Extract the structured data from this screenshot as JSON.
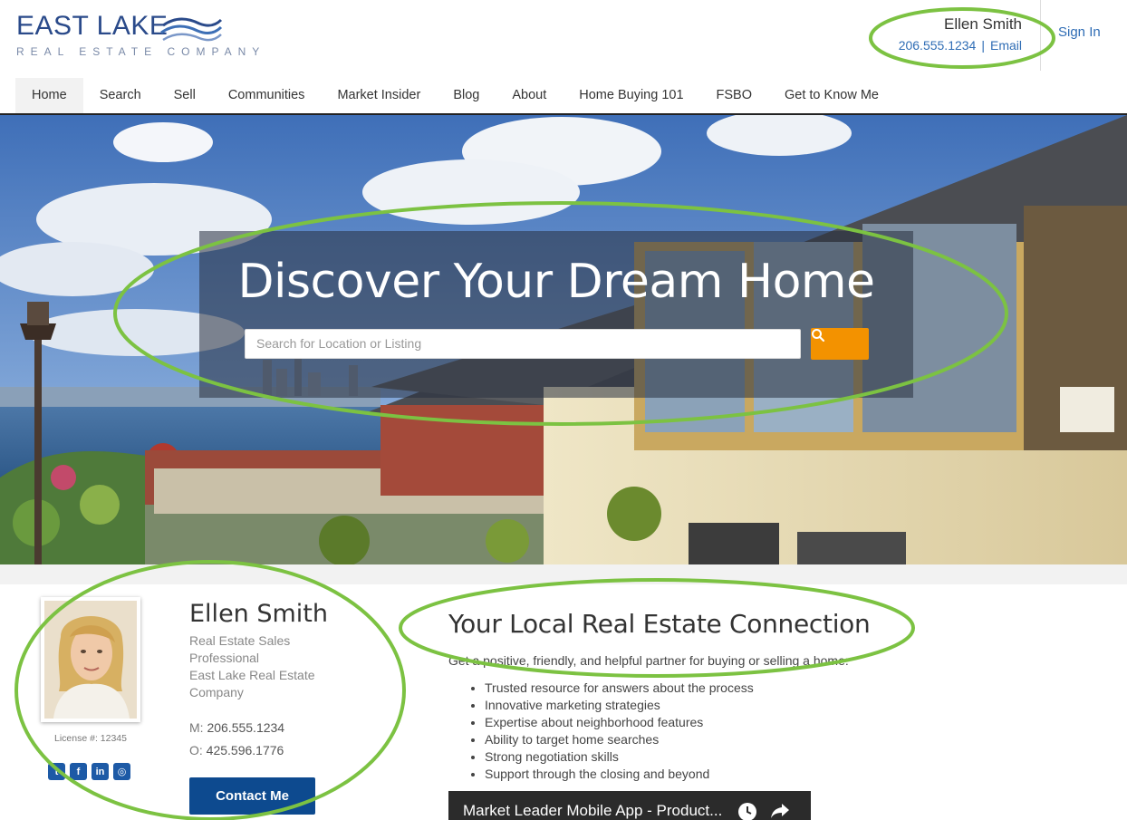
{
  "brand": {
    "name": "EAST LAKE",
    "tagline": "REAL ESTATE COMPANY"
  },
  "top_agent": {
    "name": "Ellen Smith",
    "phone": "206.555.1234",
    "separator": "|",
    "email_label": "Email"
  },
  "signin_label": "Sign In",
  "nav": {
    "items": [
      {
        "label": "Home",
        "active": true
      },
      {
        "label": "Search"
      },
      {
        "label": "Sell"
      },
      {
        "label": "Communities"
      },
      {
        "label": "Market Insider"
      },
      {
        "label": "Blog"
      },
      {
        "label": "About"
      },
      {
        "label": "Home Buying 101"
      },
      {
        "label": "FSBO"
      },
      {
        "label": "Get to Know Me"
      }
    ]
  },
  "hero": {
    "title": "Discover Your Dream Home",
    "search_placeholder": "Search for Location or Listing",
    "search_icon": "search-icon"
  },
  "agent": {
    "name": "Ellen Smith",
    "title_lines": [
      "Real Estate Sales",
      "Professional",
      "East Lake Real Estate",
      "Company"
    ],
    "license": "License #: 12345",
    "mobile_label": "M:",
    "mobile": "206.555.1234",
    "office_label": "O:",
    "office": "425.596.1776",
    "contact_button": "Contact Me",
    "socials": [
      {
        "icon": "twitter-icon",
        "glyph": "t"
      },
      {
        "icon": "facebook-icon",
        "glyph": "f"
      },
      {
        "icon": "linkedin-icon",
        "glyph": "in"
      },
      {
        "icon": "instagram-icon",
        "glyph": "◎"
      }
    ]
  },
  "connection": {
    "title": "Your Local Real Estate Connection",
    "intro": "Get a positive, friendly, and helpful partner for buying or selling a home:",
    "bullets": [
      "Trusted resource for answers about the process",
      "Innovative marketing strategies",
      "Expertise about neighborhood features",
      "Ability to target home searches",
      "Strong negotiation skills",
      "Support through the closing and beyond"
    ]
  },
  "video": {
    "title": "Market Leader Mobile App - Product...",
    "icons": [
      "clock-icon",
      "share-icon"
    ]
  },
  "colors": {
    "brand_blue": "#2a4a8a",
    "link_blue": "#2f6db5",
    "search_orange": "#f39200",
    "contact_button": "#0d4a8f",
    "annotation_green": "#7cc242"
  }
}
